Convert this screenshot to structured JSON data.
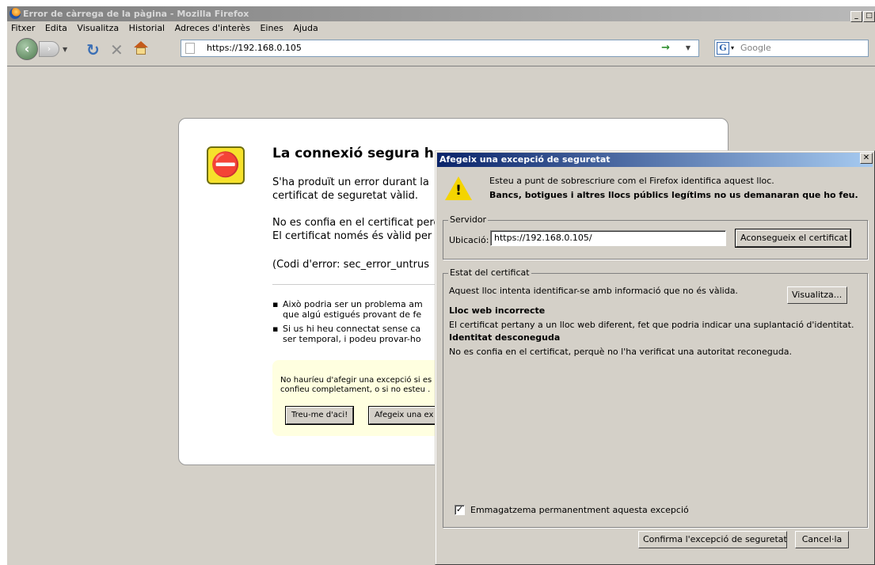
{
  "browser": {
    "title": "Error de càrrega de la pàgina - Mozilla Firefox",
    "menu": [
      "Fitxer",
      "Edita",
      "Visualitza",
      "Historial",
      "Adreces d'interès",
      "Eines",
      "Ajuda"
    ],
    "url": "https://192.168.0.105",
    "search_placeholder": "Google"
  },
  "error_page": {
    "title": "La connexió segura h",
    "para1_line1": "S'ha produït un error durant la",
    "para1_line2": "certificat de seguretat vàlid.",
    "para2_line1": "No es confia en el certificat perc",
    "para2_line2": "El certificat només és vàlid per ,",
    "code": "(Codi d'error: sec_error_untrus",
    "bullets": [
      [
        "Això podria ser un problema am",
        "que algú estigués provant de fe"
      ],
      [
        "Si us hi heu connectat sense ca",
        "ser temporal, i podeu provar-ho"
      ]
    ],
    "warning_line1": "No hauríeu d'afegir una excepció si es",
    "warning_line2": "confieu completament, o si no esteu .",
    "get_me_out_label": "Treu-me d'aci!",
    "add_exception_label": "Afegeix una ex"
  },
  "dialog": {
    "title": "Afegeix una excepció de seguretat",
    "intro1": "Esteu a punt de sobrescriure com el Firefox identifica aquest lloc.",
    "intro2": "Bancs, botigues i altres llocs públics legítims no us demanaran que ho feu.",
    "server_legend": "Servidor",
    "location_label": "Ubicació:",
    "location_value": "https://192.168.0.105/",
    "get_cert_label": "Aconsegueix el certificat",
    "status_legend": "Estat del certificat",
    "status_desc": "Aquest lloc intenta identificar-se amb informació que no és vàlida.",
    "view_label": "Visualitza...",
    "issue1_title": "Lloc web incorrecte",
    "issue1_body": "El certificat pertany a un lloc web diferent, fet que podria indicar una suplantació d'identitat.",
    "issue2_title": "Identitat desconeguda",
    "issue2_body": "No es confia en el certificat, perquè no l'ha verificat una autoritat reconeguda.",
    "permanent_label": "Emmagatzema permanentment aquesta excepció",
    "permanent_checked": true,
    "confirm_label": "Confirma l'excepció de seguretat",
    "cancel_label": "Cancel·la"
  }
}
